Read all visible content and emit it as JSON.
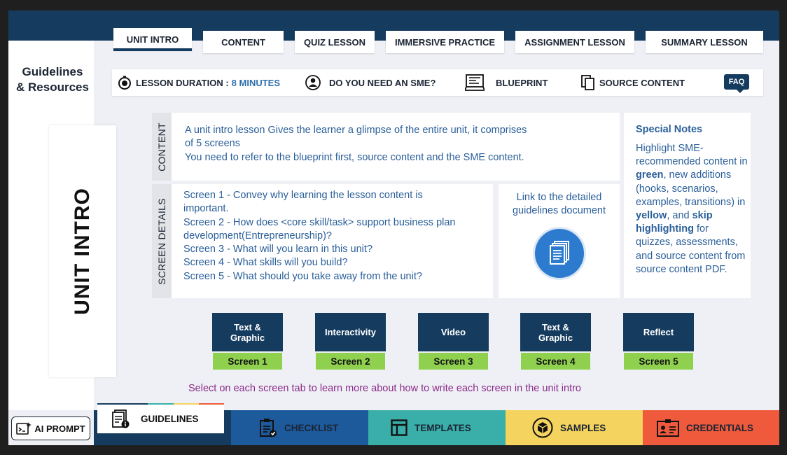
{
  "left_panel": {
    "title_line1": "Guidelines",
    "title_line2": "& Resources",
    "unit_label": "UNIT INTRO"
  },
  "top_tabs": [
    "UNIT INTRO",
    "CONTENT",
    "QUIZ LESSON",
    "IMMERSIVE PRACTICE",
    "ASSIGNMENT LESSON",
    "SUMMARY LESSON"
  ],
  "active_tab": "UNIT INTRO",
  "info_bar": {
    "duration_label": "LESSON DURATION :",
    "duration_value": "8 MINUTES",
    "sme_label": "DO YOU NEED AN SME?",
    "blueprint_label": "BLUEPRINT",
    "source_label": "SOURCE CONTENT",
    "faq_label": "FAQ"
  },
  "content_section": {
    "label": "CONTENT",
    "lines": [
      "A unit intro lesson Gives the learner a glimpse of the entire unit, it comprises",
      "of 5 screens",
      "You need to refer to the blueprint first, source content and the SME content."
    ]
  },
  "details_section": {
    "label": "SCREEN DETAILS",
    "lines": [
      "Screen 1 - Convey why learning the lesson content is",
      "important.",
      "Screen 2 - How does <core skill/task> support business plan",
      "development(Entrepreneurship)?",
      "Screen 3 - What will you learn in this unit?",
      "Screen 4 - What skills will you build?",
      "Screen 5 - What should you take away from the unit?"
    ]
  },
  "link_box": {
    "line1": "Link to the detailed",
    "line2": "guidelines document"
  },
  "special_notes": {
    "title": "Special Notes",
    "t1": "Highlight SME-recommended content in ",
    "green_word": "green",
    "t2": ", new additions (hooks, scenarios, examples, transitions) in ",
    "yellow_word": "yellow",
    "t3": ", and ",
    "skip_word": "skip highlighting",
    "t4": " for quizzes, assessments, and source content from source content PDF."
  },
  "screens": [
    {
      "type": "Text & Graphic",
      "label": "Screen 1"
    },
    {
      "type": "Interactivity",
      "label": "Screen 2"
    },
    {
      "type": "Video",
      "label": "Screen 3"
    },
    {
      "type": "Text & Graphic",
      "label": "Screen 4"
    },
    {
      "type": "Reflect",
      "label": "Screen 5"
    }
  ],
  "hint": "Select on each screen tab to learn more about how to write each screen in the unit intro",
  "bottom_tabs": [
    {
      "label": "GUIDELINES",
      "color": "#ffffff"
    },
    {
      "label": "CHECKLIST",
      "color": "#1d5a9c"
    },
    {
      "label": "TEMPLATES",
      "color": "#3aafa9"
    },
    {
      "label": "SAMPLES",
      "color": "#f4d35e"
    },
    {
      "label": "CREDENTIALS",
      "color": "#ef5a3c"
    }
  ],
  "ai_prompt_label": "AI PROMPT"
}
